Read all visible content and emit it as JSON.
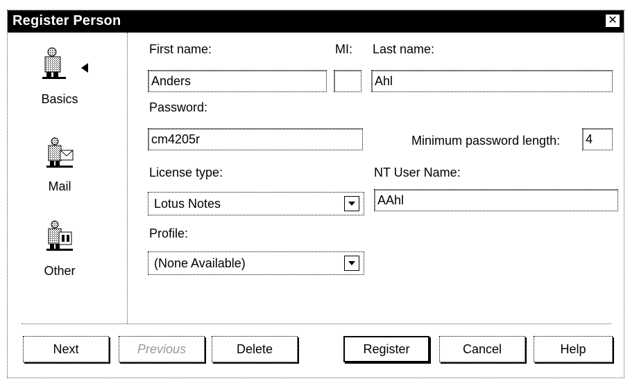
{
  "window": {
    "title": "Register Person",
    "close_label": "✕"
  },
  "nav": {
    "items": [
      {
        "label": "Basics",
        "icon": "person-icon",
        "selected": true
      },
      {
        "label": "Mail",
        "icon": "mail-person-icon",
        "selected": false
      },
      {
        "label": "Other",
        "icon": "other-person-icon",
        "selected": false
      }
    ]
  },
  "form": {
    "first_name": {
      "label": "First name:",
      "value": "Anders"
    },
    "mi": {
      "label": "MI:",
      "value": ""
    },
    "last_name": {
      "label": "Last name:",
      "value": "Ahl"
    },
    "password": {
      "label": "Password:",
      "value": "cm4205r"
    },
    "min_password_length": {
      "label": "Minimum password length:",
      "value": "4"
    },
    "license_type": {
      "label": "License type:",
      "value": "Lotus Notes"
    },
    "nt_user_name": {
      "label": "NT User Name:",
      "value": "AAhl"
    },
    "profile": {
      "label": "Profile:",
      "value": "(None Available)"
    }
  },
  "buttons": {
    "next": "Next",
    "previous": "Previous",
    "delete": "Delete",
    "register": "Register",
    "cancel": "Cancel",
    "help": "Help"
  }
}
